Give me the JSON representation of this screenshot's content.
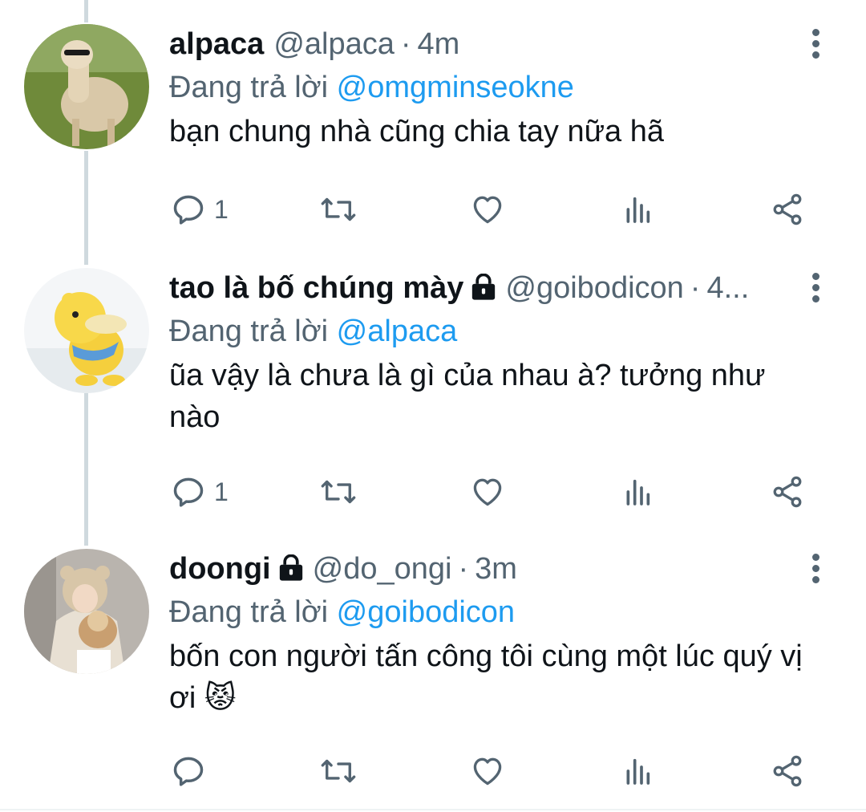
{
  "tweets": [
    {
      "name": "alpaca",
      "handle": "@alpaca",
      "separator": "·",
      "time": "4m",
      "locked": false,
      "reply_prefix": "Đang trả lời",
      "reply_to": "@omgminseokne",
      "text": "bạn chung nhà cũng chia tay nữa hã",
      "reply_count": "1",
      "avatar_icon": "alpaca-avatar"
    },
    {
      "name": "tao là bố chúng mày",
      "handle": "@goibodicon",
      "separator": "·",
      "time": "4...",
      "locked": true,
      "reply_prefix": "Đang trả lời",
      "reply_to": "@alpaca",
      "text": "ũa vậy là chưa là gì của nhau à? tưởng như nào",
      "reply_count": "1",
      "avatar_icon": "psyduck-avatar"
    },
    {
      "name": "doongi",
      "handle": "@do_ongi",
      "separator": "·",
      "time": "3m",
      "locked": true,
      "reply_prefix": "Đang trả lời",
      "reply_to": "@goibodicon",
      "text": "bốn con người tấn công tôi cùng một lúc quý vị ơi 😾",
      "reply_count": "",
      "avatar_icon": "person-with-dog-avatar"
    }
  ],
  "colors": {
    "text": "#0f1419",
    "secondary": "#536471",
    "link": "#1d9bf0",
    "thread_line": "#cfd9de"
  },
  "icons": [
    "reply-icon",
    "retweet-icon",
    "like-icon",
    "views-icon",
    "share-icon",
    "more-options-icon",
    "lock-icon"
  ]
}
